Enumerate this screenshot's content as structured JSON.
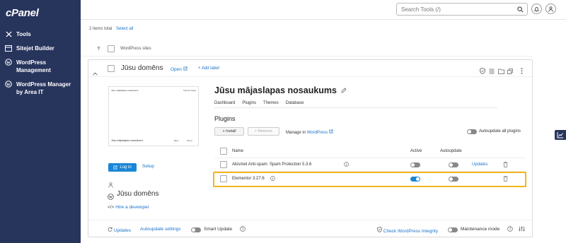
{
  "sidebar": {
    "logo": "cPanel",
    "items": [
      {
        "label": "Tools",
        "icon": "tools-icon"
      },
      {
        "label": "Sitejet Builder",
        "icon": "sitejet-icon"
      },
      {
        "label": "WordPress Management",
        "icon": "wordpress-icon"
      },
      {
        "label": "WordPress Manager by Area IT",
        "icon": "wordpress-icon"
      }
    ]
  },
  "topbar": {
    "search_placeholder": "Search Tools (/)"
  },
  "list": {
    "count_text": "2 items total",
    "select_all": "Select all",
    "group_label": "WordPress sites"
  },
  "site": {
    "name": "Jūsu domēns",
    "open_label": "Open",
    "add_label": "+ Add label",
    "thumb_header_left": "Jūsu mājaslapas nosaukums",
    "thumb_header_right": "Sample Page",
    "thumb_footer_left": "Jūsu mājaslapas nosaukums",
    "thumb_footer_mid": "Blog",
    "thumb_footer_right": "About",
    "login_label": "Log in",
    "setup_label": "Setup",
    "domain": "Jūsu domēns",
    "hire_label": "Hire a developer",
    "title": "Jūsu mājaslapas nosaukums",
    "tabs": [
      "Dashboard",
      "Plugins",
      "Themes",
      "Database"
    ],
    "active_tab": "Plugins",
    "plugins": {
      "heading": "Plugins",
      "install_label": "+ Install",
      "remove_label": "× Remove",
      "manage_label": "Manage in",
      "manage_link": "WordPress",
      "autoupdate_all_label": "Autoupdate all plugins",
      "columns": {
        "name": "Name",
        "active": "Active",
        "autoupdate": "Autoupdate"
      },
      "rows": [
        {
          "name": "Akismet Anti-spam: Spam Protection 5.3.6",
          "active": false,
          "autoupdate": false,
          "updates": "Updates"
        },
        {
          "name": "Elementor 3.27.6",
          "active": true,
          "autoupdate": false,
          "updates": ""
        }
      ]
    },
    "footer": {
      "updates": "Updates",
      "autoupdate_settings": "Autoupdate settings",
      "smart_update": "Smart Update",
      "integrity": "Check WordPress Integrity",
      "maintenance": "Maintenance mode"
    }
  },
  "colors": {
    "sidebar": "#27345c",
    "accent": "#1a86d6",
    "highlight": "#f2b61b"
  }
}
